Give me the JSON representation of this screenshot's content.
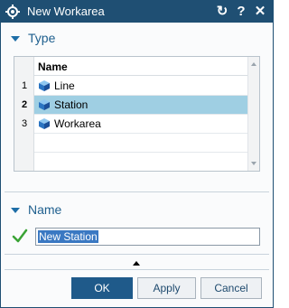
{
  "window": {
    "title": "New Workarea",
    "buttons": {
      "reset_glyph": "↻",
      "help_glyph": "?",
      "close_glyph": "✕"
    }
  },
  "type_section": {
    "label": "Type",
    "column_header": "Name",
    "rows": [
      {
        "num": "1",
        "label": "Line",
        "icon": "cube-icon"
      },
      {
        "num": "2",
        "label": "Station",
        "icon": "cube-icon",
        "selected": true
      },
      {
        "num": "3",
        "label": "Workarea",
        "icon": "cube-icon"
      }
    ]
  },
  "name_section": {
    "label": "Name",
    "value": "New Station"
  },
  "footer": {
    "ok_label": "OK",
    "apply_label": "Apply",
    "cancel_label": "Cancel"
  },
  "colors": {
    "titlebar": "#1f4f73",
    "accent": "#1e6ea7",
    "selection": "#9fcfe3",
    "primary_button": "#1f5a8a"
  }
}
